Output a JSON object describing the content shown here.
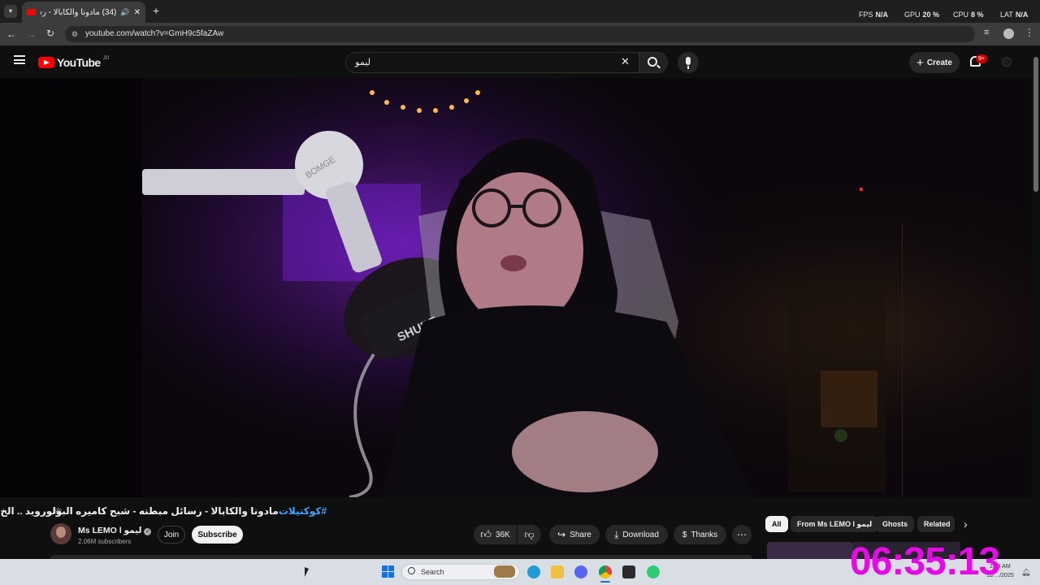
{
  "browser": {
    "tab_title": "(34) مادونا والكابالا - رسائل...",
    "new_tab_label": "+",
    "url": "youtube.com/watch?v=GmH9c5faZAw",
    "overlay_stats": [
      {
        "label": "FPS",
        "value": "N/A"
      },
      {
        "label": "GPU",
        "value": "20 %"
      },
      {
        "label": "CPU",
        "value": "8 %"
      },
      {
        "label": "LAT",
        "value": "N/A"
      }
    ]
  },
  "youtube": {
    "logo_text": "YouTube",
    "country_code": "JO",
    "search_query": "ليمو",
    "create_label": "Create",
    "notification_count": "9+"
  },
  "video": {
    "title_hashtag": "#كوكتيلات",
    "title_text": "مادونا والكابالا - رسائل مبطنه - شبح كاميره البولورويد .. الخ",
    "mic_label": "SHURE",
    "boom_label": "BOMGE"
  },
  "channel": {
    "name": "Ms LEMO l ليمو",
    "subscribers": "2.06M subscribers",
    "join_label": "Join",
    "subscribe_label": "Subscribe"
  },
  "actions": {
    "likes": "36K",
    "share_label": "Share",
    "download_label": "Download",
    "thanks_label": "Thanks"
  },
  "chips": [
    "All",
    "From Ms LEMO l ليمو",
    "Ghosts",
    "Related"
  ],
  "taskbar": {
    "search_placeholder": "Search",
    "time": "2:54 AM",
    "date": "11/…/2025"
  },
  "overlay_clock": "06:35:13",
  "colors": {
    "youtube_red": "#ff0000",
    "clock_magenta": "#e60be6",
    "hashtag_blue": "#3ea6ff"
  }
}
